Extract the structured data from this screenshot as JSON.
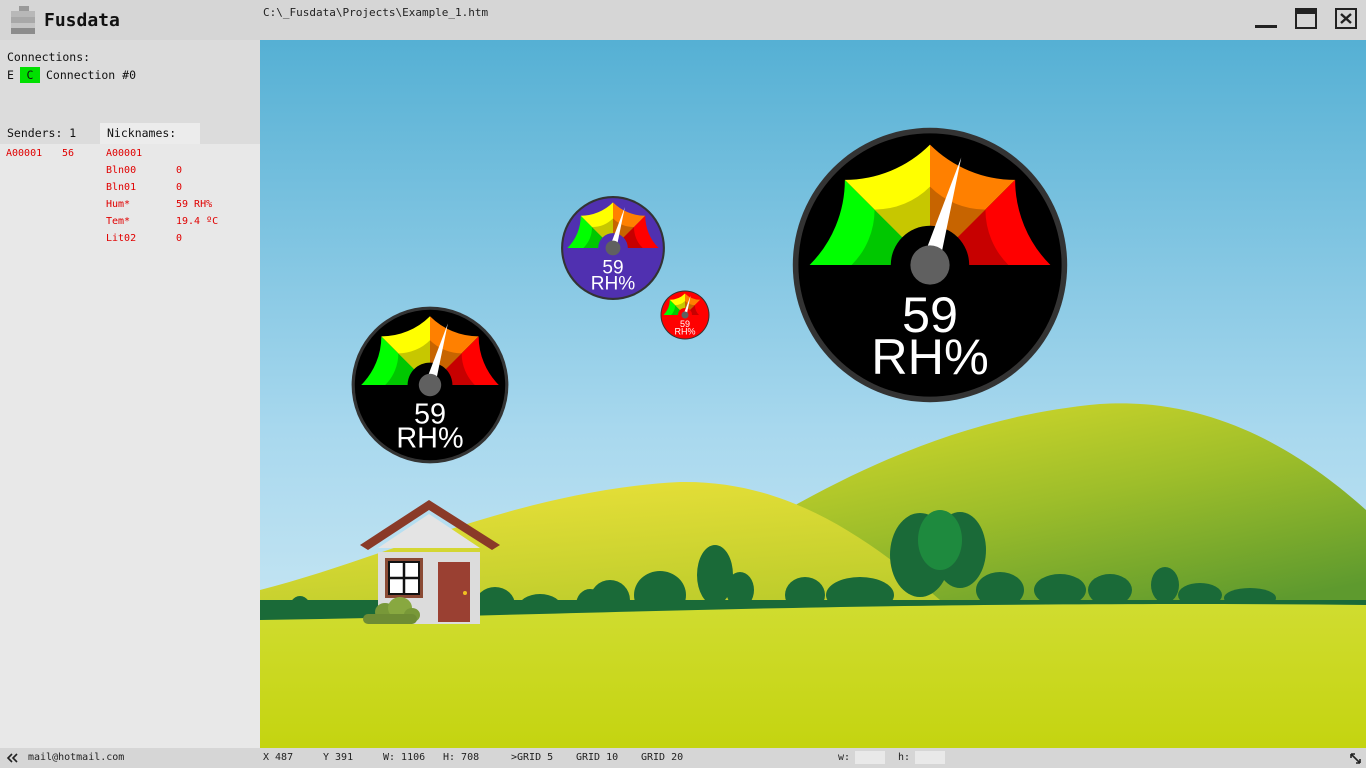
{
  "app": {
    "title": "Fusdata",
    "file_path": "C:\\_Fusdata\\Projects\\Example_1.htm"
  },
  "connections": {
    "label": "Connections:",
    "e_label": "E",
    "c_label": "C",
    "name": "Connection #0"
  },
  "tabs": {
    "senders": "Senders: 1",
    "nicknames": "Nicknames:"
  },
  "sender": {
    "id": "A00001",
    "value": "56"
  },
  "nicknames": {
    "header": "A00001",
    "items": [
      {
        "name": "Bln00",
        "value": "0"
      },
      {
        "name": "Bln01",
        "value": "0"
      },
      {
        "name": "Hum*",
        "value": "59 RH%"
      },
      {
        "name": "Tem*",
        "value": "19.4 ºC"
      },
      {
        "name": "Lit02",
        "value": "0"
      }
    ]
  },
  "gauges": {
    "value": "59",
    "unit": "RH%",
    "level": 0.59,
    "colors": {
      "green": "#00ff00",
      "yellow": "#ffff00",
      "orange": "#ff8000",
      "red": "#ff0000",
      "hub": "#606060",
      "bezel": "#333333"
    },
    "items": [
      {
        "face": "#000000"
      },
      {
        "face": "#5030b0"
      },
      {
        "face": "#ff0000"
      },
      {
        "face": "#000000"
      }
    ]
  },
  "status": {
    "email": "mail@hotmail.com",
    "x": "X 487",
    "y": "Y 391",
    "w": "W: 1106",
    "h": "H: 708",
    "grid_5": ">GRID 5",
    "grid_10": "GRID 10",
    "grid_20": "GRID 20",
    "w_label": "w:",
    "h_label": "h:"
  }
}
